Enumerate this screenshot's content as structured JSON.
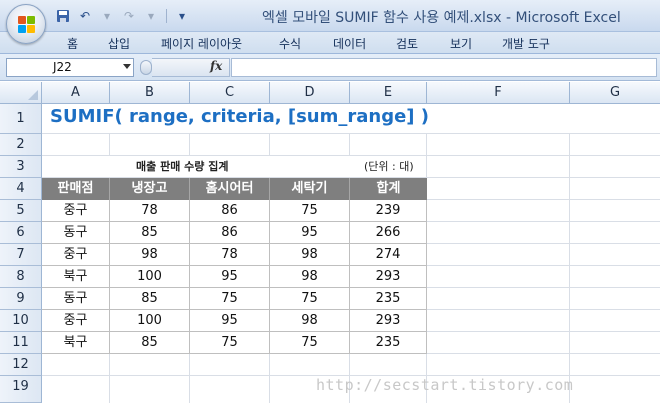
{
  "window": {
    "title": "엑셀 모바일 SUMIF 함수 사용 예제.xlsx - Microsoft Excel"
  },
  "ribbon": {
    "tabs": [
      "홈",
      "삽입",
      "페이지 레이아웃",
      "수식",
      "데이터",
      "검토",
      "보기",
      "개발 도구"
    ]
  },
  "formula_bar": {
    "name_box": "J22",
    "fx_label": "fx",
    "formula": ""
  },
  "columns": [
    "A",
    "B",
    "C",
    "D",
    "E",
    "F",
    "G"
  ],
  "rows": [
    "1",
    "2",
    "3",
    "4",
    "5",
    "6",
    "7",
    "8",
    "9",
    "10",
    "11",
    "12",
    "19"
  ],
  "sheet": {
    "title": "SUMIF( range, criteria, [sum_range] )",
    "caption": "매출 판매 수량 집계",
    "unit": "(단위 : 대)",
    "headers": [
      "판매점",
      "냉장고",
      "홈시어터",
      "세탁기",
      "합계"
    ],
    "data": [
      [
        "중구",
        "78",
        "86",
        "75",
        "239"
      ],
      [
        "동구",
        "85",
        "86",
        "95",
        "266"
      ],
      [
        "중구",
        "98",
        "78",
        "98",
        "274"
      ],
      [
        "북구",
        "100",
        "95",
        "98",
        "293"
      ],
      [
        "동구",
        "85",
        "75",
        "75",
        "235"
      ],
      [
        "중구",
        "100",
        "95",
        "98",
        "293"
      ],
      [
        "북구",
        "85",
        "75",
        "75",
        "235"
      ]
    ]
  },
  "watermark": "http://secstart.tistory.com",
  "colors": {
    "title_blue": "#1d6fc3",
    "header_gray": "#7f7f7f"
  }
}
